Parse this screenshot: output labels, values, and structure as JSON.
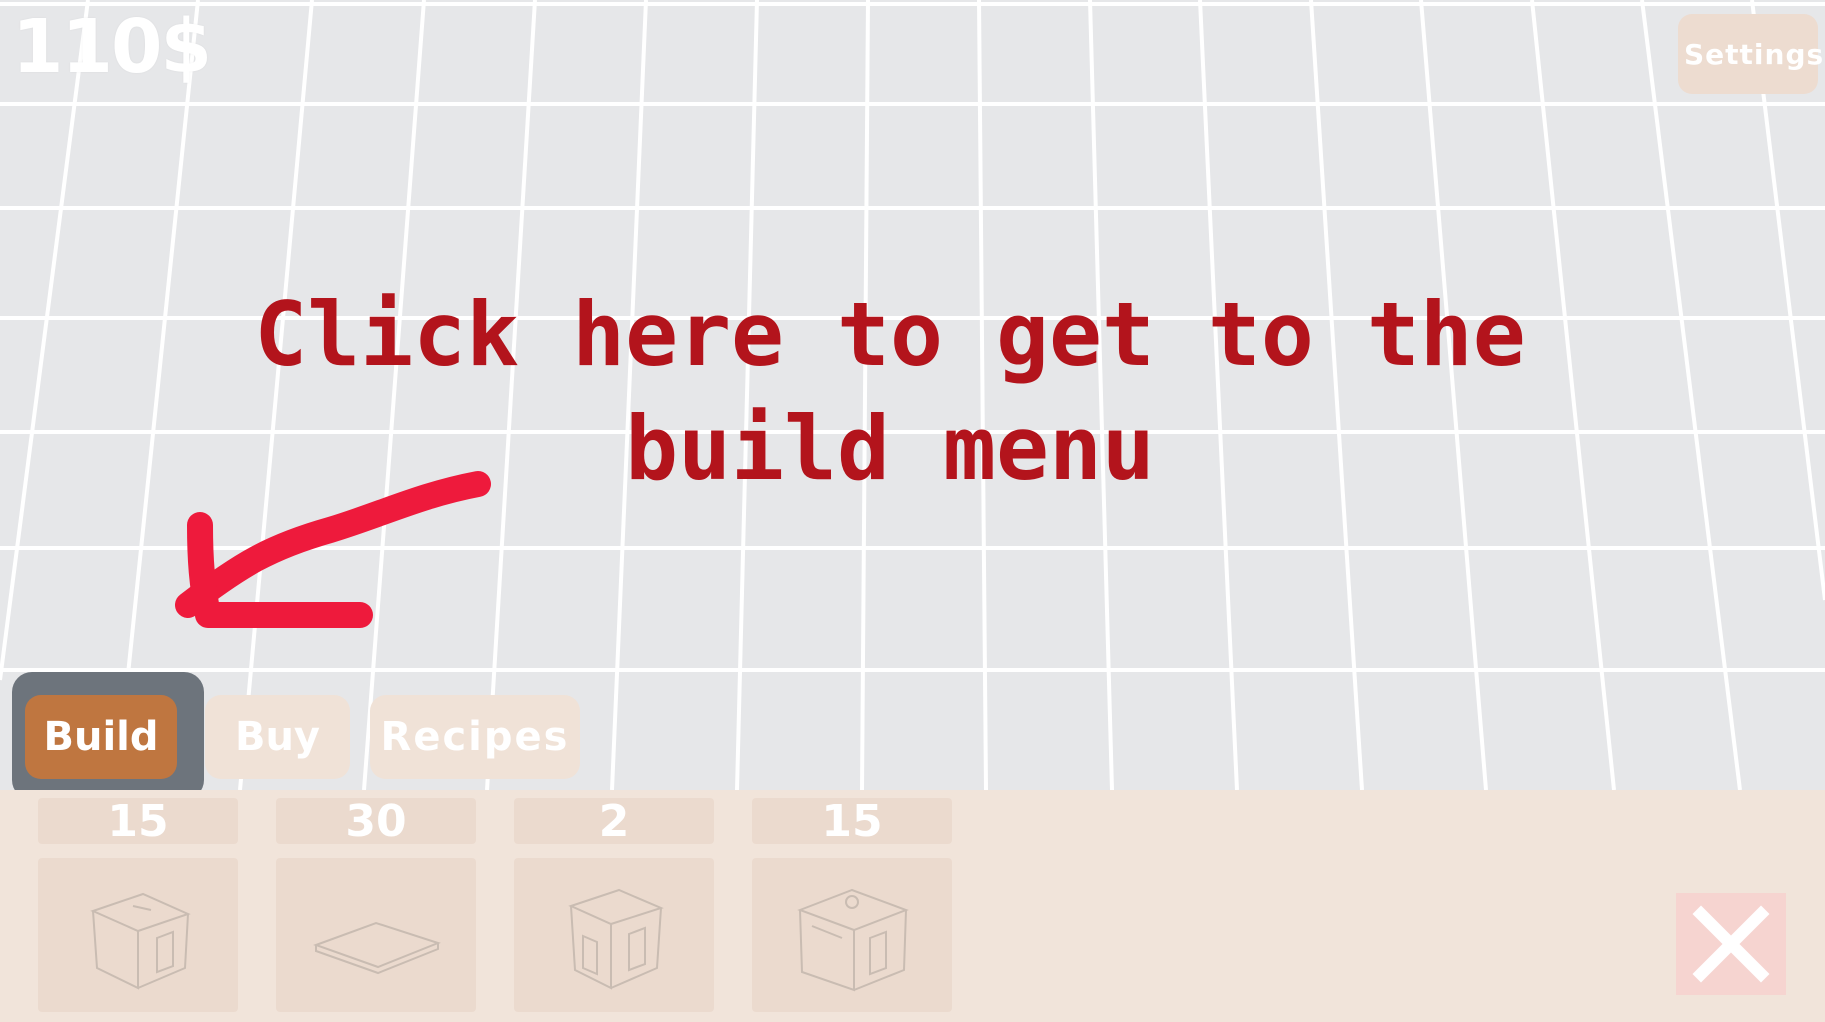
{
  "hud": {
    "money": "110$",
    "settings_label": "Settings"
  },
  "tutorial": {
    "line1": "Click here to get to the",
    "line2": "build menu"
  },
  "tabs": [
    {
      "label": "Build",
      "active": true
    },
    {
      "label": "Buy",
      "active": false
    },
    {
      "label": "Recipes",
      "active": false
    }
  ],
  "build_items": [
    {
      "price": "15",
      "icon": "house-sketch-icon"
    },
    {
      "price": "30",
      "icon": "floor-tile-sketch-icon"
    },
    {
      "price": "2",
      "icon": "wall-block-sketch-icon"
    },
    {
      "price": "15",
      "icon": "building-sketch-icon"
    }
  ],
  "colors": {
    "hint_text": "#b3141c",
    "arrow": "#ee1a3c",
    "active_tab": "#bf7640",
    "inactive_tab": "#f0e2d7",
    "panel": "#f1e4da"
  }
}
